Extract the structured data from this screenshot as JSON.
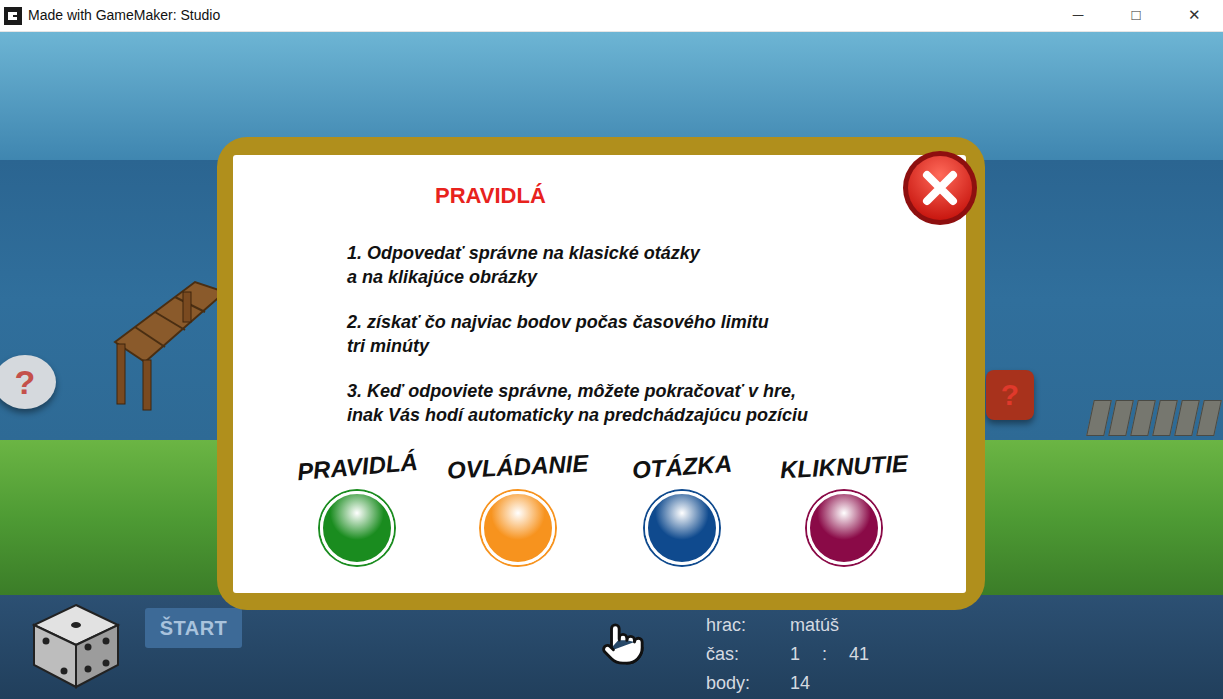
{
  "window": {
    "title": "Made with GameMaker: Studio",
    "controls": [
      "─",
      "□",
      "✕"
    ]
  },
  "scene": {
    "markers": [
      {
        "label": "?",
        "kind": "stone"
      },
      {
        "label": "?",
        "kind": "crate"
      }
    ]
  },
  "dialog": {
    "title": "PRAVIDLÁ",
    "rules": [
      {
        "lines": [
          "1. Odpovedať správne na klasické otázky",
          "a na klikajúce obrázky"
        ]
      },
      {
        "lines": [
          "2. získať čo najviac bodov počas časového limitu",
          "tri minúty"
        ]
      },
      {
        "lines": [
          "3. Keď odpoviete správne, môžete pokračovať v hre,",
          "inak Vás hodí automaticky na predchádzajúcu pozíciu"
        ]
      }
    ],
    "buttons": [
      {
        "label": "PRAVIDLÁ",
        "color": "#1a8c1f"
      },
      {
        "label": "OVLÁDANIE",
        "color": "#f7931e"
      },
      {
        "label": "OTÁZKA",
        "color": "#0f4a8e"
      },
      {
        "label": "KLIKNUTIE",
        "color": "#8a0a47"
      }
    ]
  },
  "toolbar": {
    "start": "ŠTART"
  },
  "stats": {
    "player": {
      "label": "hrac:",
      "value": "matúš"
    },
    "time": {
      "label": "čas:",
      "minutes": "1",
      "separator": ":",
      "seconds": "41"
    },
    "score": {
      "label": "body:",
      "value": "14"
    }
  }
}
